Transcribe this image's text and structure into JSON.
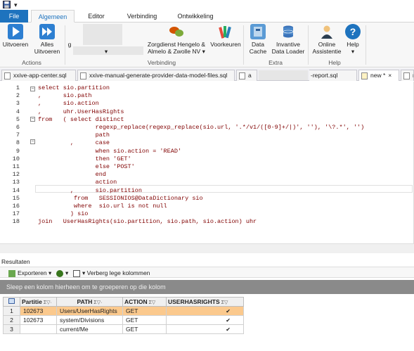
{
  "quick_access": {
    "save_icon": "save-icon",
    "dropdown_icon": "chevron-down-icon"
  },
  "ribbon_tabs": [
    "File",
    "Algemeen",
    "Editor",
    "Verbinding",
    "Ontwikkeling"
  ],
  "ribbon": {
    "uitvoeren": "Uitvoeren",
    "alles_line1": "Alles",
    "alles_line2": "Uitvoeren",
    "actions_group": "Actions",
    "g_label": "g",
    "zorg_line1": "Zorgdienst Hengelo &",
    "zorg_line2": "Almelo & Zwolle NV",
    "voorkeuren": "Voorkeuren",
    "verbinding_group": "Verbinding",
    "datacache_line1": "Data",
    "datacache_line2": "Cache",
    "invantive_line1": "Invantive",
    "invantive_line2": "Data Loader",
    "extra_group": "Extra",
    "online_line1": "Online",
    "online_line2": "Assistentie",
    "help": "Help",
    "help_group": "Help"
  },
  "doc_tabs": [
    {
      "label": "xxive-app-center.sql"
    },
    {
      "label": "xxive-manual-generate-provider-data-model-files.sql"
    },
    {
      "label": "a"
    },
    {
      "label": "-report.sql"
    },
    {
      "label": "new *"
    },
    {
      "label": "n"
    }
  ],
  "editor": {
    "line_numbers": [
      "1",
      "2",
      "3",
      "4",
      "5",
      "6",
      "7",
      "8",
      "9",
      "10",
      "11",
      "12",
      "13",
      "14",
      "15",
      "16",
      "17",
      "18"
    ],
    "lines": [
      "select sio.partition",
      ",      sio.path",
      ",      sio.action",
      ",      uhr.UserHasRights",
      "from   ( select distinct",
      "                regexp_replace(regexp_replace(sio.url, '.*/v1/([0-9]+/|)', ''), '\\?.*', '')",
      "                path",
      "         ,      case",
      "                when sio.action = 'READ'",
      "                then 'GET'",
      "                else 'POST'",
      "                end",
      "                action",
      "         ,      sio.partition",
      "          from   SESSIONIOS@DataDictionary sio",
      "          where  sio.url is not null",
      "         ) sio",
      "join   UserHasRights(sio.partition, sio.path, sio.action) uhr"
    ]
  },
  "results": {
    "title": "Resultaten",
    "export_label": "Exporteren",
    "hide_empty_label": "Verberg lege kolommen",
    "group_hint": "Sleep een kolom hierheen om te groeperen op die kolom",
    "columns": [
      "Partitie",
      "PATH",
      "ACTION",
      "USERHASRIGHTS"
    ],
    "rows": [
      {
        "num": "1",
        "partitie": "102673",
        "path": "Users/UserHasRights",
        "action": "GET",
        "userhasrights": true
      },
      {
        "num": "2",
        "partitie": "102673",
        "path": "system/Divisions",
        "action": "GET",
        "userhasrights": true
      },
      {
        "num": "3",
        "partitie": "",
        "path": "current/Me",
        "action": "GET",
        "userhasrights": true
      }
    ]
  },
  "colors": {
    "accent": "#1e73be",
    "selected_row": "#fbc98d",
    "group_bar": "#8a8a8a"
  }
}
